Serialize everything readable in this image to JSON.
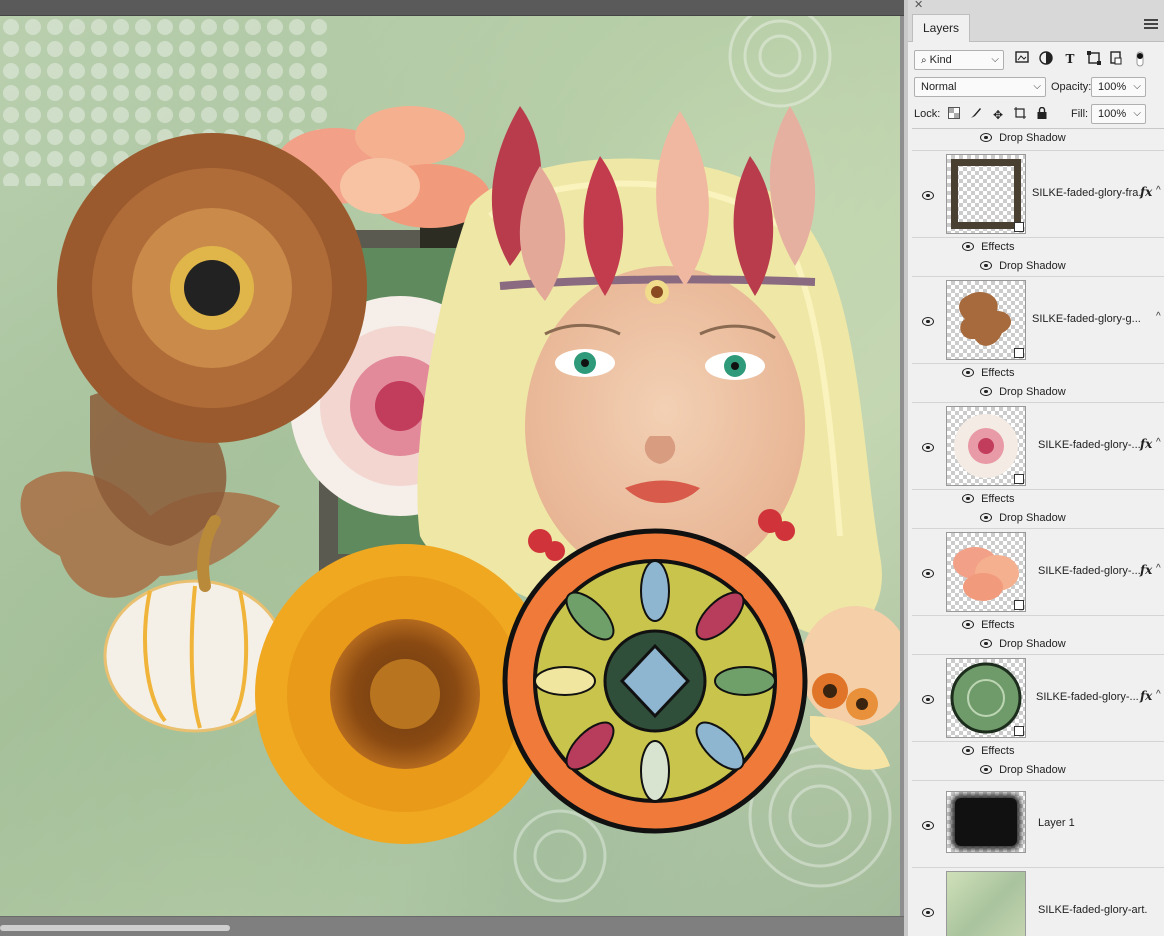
{
  "panel": {
    "tab": "Layers",
    "close_symbol": "✕",
    "filter_kind": "Kind",
    "blend_mode": "Normal",
    "opacity_label": "Opacity:",
    "opacity_value": "100%",
    "lock_label": "Lock:",
    "fill_label": "Fill:",
    "fill_value": "100%"
  },
  "layers_list": {
    "top_effect": "Drop Shadow",
    "effects_label": "Effects",
    "effect_label": "Drop Shadow",
    "layers": [
      {
        "name": "SILKE-faded-glory-fra...",
        "fx": true
      },
      {
        "name": "SILKE-faded-glory-g...",
        "fx": true
      },
      {
        "name": "SILKE-faded-glory-...",
        "fx": true
      },
      {
        "name": "SILKE-faded-glory-...",
        "fx": true
      },
      {
        "name": "SILKE-faded-glory-...",
        "fx": true
      },
      {
        "name": "Layer 1",
        "fx": false
      },
      {
        "name": "SILKE-faded-glory-art...",
        "fx": false
      }
    ]
  },
  "icons": {
    "fx": "fx",
    "caret": "^"
  }
}
